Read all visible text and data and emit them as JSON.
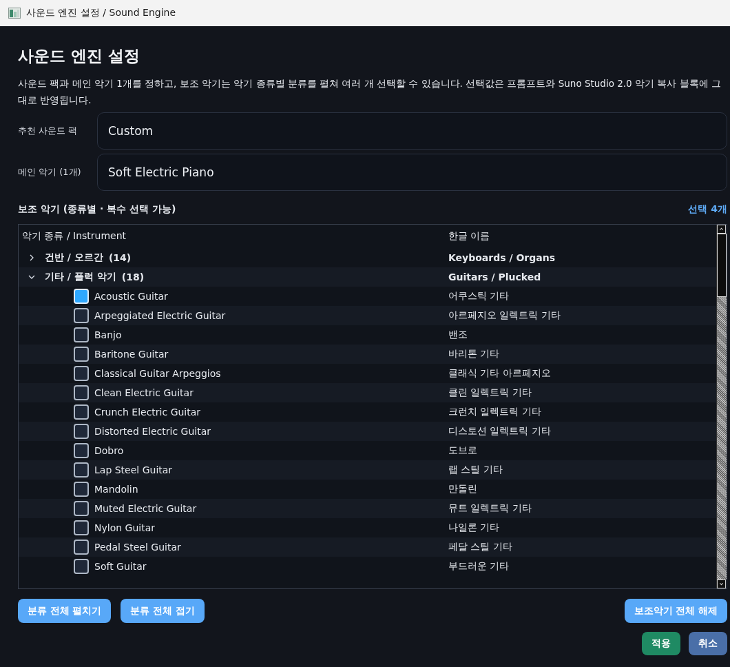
{
  "window": {
    "title": "사운드 엔진 설정 / Sound Engine"
  },
  "heading": "사운드 엔진 설정",
  "description": "사운드 팩과 메인 악기 1개를 정하고, 보조 악기는 악기 종류별 분류를 펼쳐 여러 개 선택할 수 있습니다. 선택값은 프롬프트와 Suno Studio 2.0 악기 복사 블록에 그대로 반영됩니다.",
  "fields": [
    {
      "label": "추천 사운드 팩",
      "value": "Custom"
    },
    {
      "label": "메인 악기 (1개)",
      "value": "Soft Electric Piano"
    }
  ],
  "secondary": {
    "title": "보조 악기 (종류별 · 복수 선택 가능)",
    "count": "선택 4개"
  },
  "tree": {
    "columns": [
      "악기 종류 / Instrument",
      "한글 이름"
    ],
    "groups": [
      {
        "name": "건반 / 오르간",
        "count": "(14)",
        "english": "Keyboards / Organs",
        "expanded": false
      },
      {
        "name": "기타 / 플럭 악기",
        "count": "(18)",
        "english": "Guitars / Plucked",
        "expanded": true,
        "children": [
          {
            "name": "Acoustic Guitar",
            "korean": "어쿠스틱 기타",
            "checked": true
          },
          {
            "name": "Arpeggiated Electric Guitar",
            "korean": "아르페지오 일렉트릭 기타",
            "checked": false
          },
          {
            "name": "Banjo",
            "korean": "밴조",
            "checked": false
          },
          {
            "name": "Baritone Guitar",
            "korean": "바리톤 기타",
            "checked": false
          },
          {
            "name": "Classical Guitar Arpeggios",
            "korean": "클래식 기타 아르페지오",
            "checked": false
          },
          {
            "name": "Clean Electric Guitar",
            "korean": "클린 일렉트릭 기타",
            "checked": false
          },
          {
            "name": "Crunch Electric Guitar",
            "korean": "크런치 일렉트릭 기타",
            "checked": false
          },
          {
            "name": "Distorted Electric Guitar",
            "korean": "디스토션 일렉트릭 기타",
            "checked": false
          },
          {
            "name": "Dobro",
            "korean": "도브로",
            "checked": false
          },
          {
            "name": "Lap Steel Guitar",
            "korean": "랩 스틸 기타",
            "checked": false
          },
          {
            "name": "Mandolin",
            "korean": "만돌린",
            "checked": false
          },
          {
            "name": "Muted Electric Guitar",
            "korean": "뮤트 일렉트릭 기타",
            "checked": false
          },
          {
            "name": "Nylon Guitar",
            "korean": "나일론 기타",
            "checked": false
          },
          {
            "name": "Pedal Steel Guitar",
            "korean": "페달 스틸 기타",
            "checked": false
          },
          {
            "name": "Soft Guitar",
            "korean": "부드러운 기타",
            "checked": false
          }
        ]
      }
    ]
  },
  "tree_buttons": [
    "분류 전체 펼치기",
    "분류 전체 접기"
  ],
  "clear_button": "보조악기 전체 해제",
  "dialog_buttons": [
    {
      "label": "적용",
      "kind": "primary"
    },
    {
      "label": "취소",
      "kind": "secondary"
    }
  ]
}
